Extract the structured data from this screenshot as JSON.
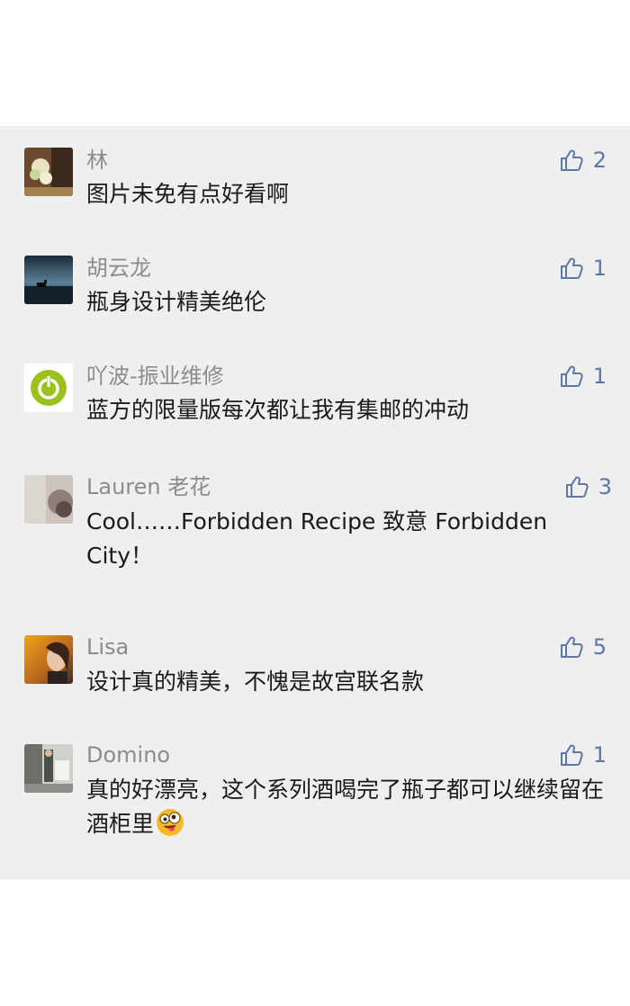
{
  "comments": [
    {
      "name": "林",
      "text": "图片未免有点好看啊",
      "likes": "2"
    },
    {
      "name": "胡云龙",
      "text": "瓶身设计精美绝伦",
      "likes": "1"
    },
    {
      "name": "吖波-振业维修",
      "text": "蓝方的限量版每次都让我有集邮的冲动",
      "likes": "1"
    },
    {
      "name": "Lauren 老花",
      "text": "Cool……Forbidden Recipe 致意 Forbidden City！",
      "likes": "3"
    },
    {
      "name": "Lisa",
      "text": "设计真的精美，不愧是故宫联名款",
      "likes": "5"
    },
    {
      "name": "Domino",
      "text": "真的好漂亮，这个系列酒喝完了瓶子都可以继续留在酒柜里",
      "likes": "1",
      "emoji": "crazy-face-emoji"
    }
  ],
  "icons": {
    "like": "thumbs-up-icon"
  },
  "colors": {
    "panel_bg": "#efefef",
    "name": "#8c8c8c",
    "text": "#1a1a1a",
    "like": "#5e77a6"
  }
}
